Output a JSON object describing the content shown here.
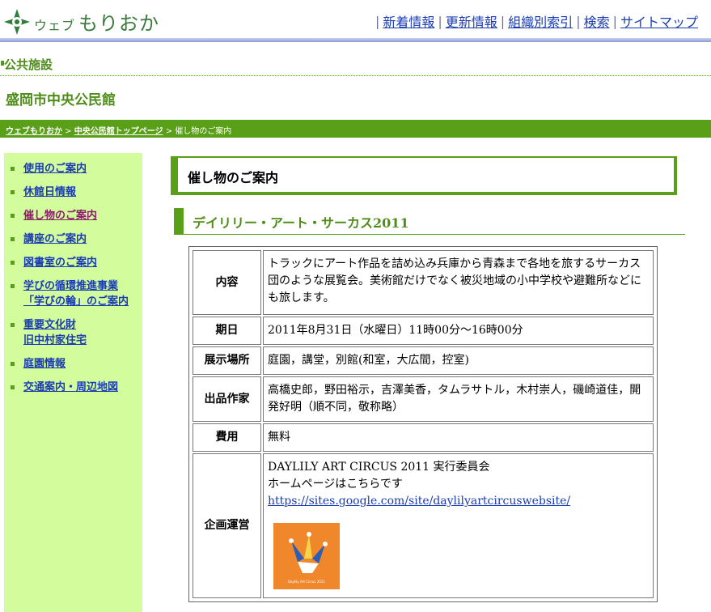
{
  "header": {
    "logo_small": "ウェブ",
    "logo_big": "もりおか",
    "nav": [
      "新着情報",
      "更新情報",
      "組織別索引",
      "検索",
      "サイトマップ"
    ],
    "sep": "|"
  },
  "category": "公共施設",
  "site_title": "盛岡市中央公民館",
  "breadcrumb": {
    "home": "ウェブもりおか",
    "parent": "中央公民館トップページ",
    "sep": " > ",
    "current": "催し物のご案内"
  },
  "sidebar": {
    "items": [
      {
        "label": "使用のご案内"
      },
      {
        "label": "休館日情報"
      },
      {
        "label": "催し物のご案内"
      },
      {
        "label": "講座のご案内"
      },
      {
        "label": "図書室のご案内"
      },
      {
        "label": "学びの循環推進事業",
        "label2": "「学びの輪」のご案内"
      },
      {
        "label": "重要文化財",
        "label2": "旧中村家住宅"
      },
      {
        "label": "庭園情報"
      },
      {
        "label": "交通案内・周辺地図"
      }
    ]
  },
  "page_heading": "催し物のご案内",
  "section_heading": "デイリリー・アート・サーカス2011",
  "table": {
    "rows": [
      {
        "th": "内容",
        "td": "トラックにアート作品を詰め込み兵庫から青森まで各地を旅するサーカス団のような展覧会。美術館だけでなく被災地域の小中学校や避難所などにも旅します。"
      },
      {
        "th": "期日",
        "td": "2011年8月31日（水曜日）11時00分～16時00分"
      },
      {
        "th": "展示場所",
        "td": "庭園，講堂，別館(和室，大広間，控室)"
      },
      {
        "th": "出品作家",
        "td": "高橋史郎，野田裕示，吉澤美香，タムラサトル，木村崇人，磯崎道佳，開発好明（順不同，敬称略）"
      },
      {
        "th": "費用",
        "td": "無料"
      }
    ],
    "org": {
      "th": "企画運営",
      "line1": "DAYLILY ART CIRCUS 2011 実行委員会",
      "line2": "ホームページはこちらです",
      "link": "https://sites.google.com/site/daylilyartcircuswebsite/",
      "image_text": "Daylily Art Circus 2011"
    }
  },
  "colors": {
    "green": "#5a9f18",
    "sidebar_bg": "#d3fc9d",
    "link": "#1a3cb3"
  }
}
